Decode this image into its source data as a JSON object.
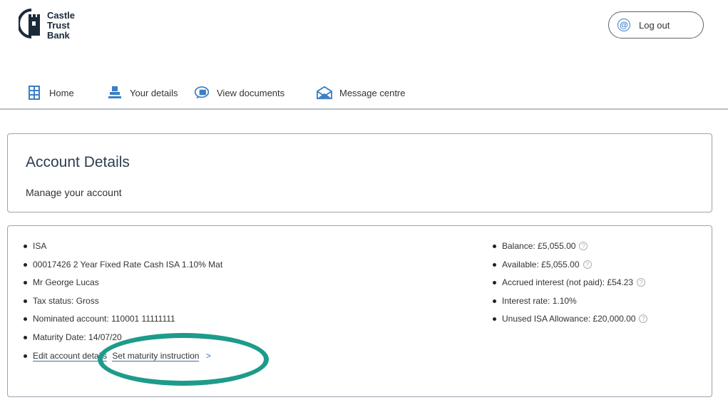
{
  "brand": {
    "line1": "Castle",
    "line2": "Trust",
    "line3": "Bank",
    "color": "#1b2a3a"
  },
  "header": {
    "logout_label": "Log out",
    "logout_icon": "at-icon"
  },
  "nav": {
    "items": [
      {
        "label": "Home",
        "icon": "home-icon"
      },
      {
        "label": "Your details",
        "icon": "user-icon"
      },
      {
        "label": "View documents",
        "icon": "documents-icon"
      },
      {
        "label": "Message centre",
        "icon": "envelope-icon"
      }
    ],
    "accent": "#3b7fc4"
  },
  "account_header": {
    "title": "Account Details",
    "subtitle": "Manage your account"
  },
  "account": {
    "left": [
      "ISA",
      "00017426 2 Year Fixed Rate Cash ISA 1.10% Mat",
      "Mr George Lucas",
      "Tax status: Gross",
      "Nominated account: 110001 11111111",
      "Maturity Date: 14/07/20"
    ],
    "links": {
      "edit": "Edit account details",
      "maturity": "Set maturity instruction"
    },
    "right": [
      "Balance: £5,055.00",
      "Available: £5,055.00",
      "Accrued interest (not paid): £54.23",
      "Interest rate: 1.10%",
      "Unused ISA Allowance: £20,000.00"
    ]
  },
  "highlight_color": "#1e9b8a"
}
